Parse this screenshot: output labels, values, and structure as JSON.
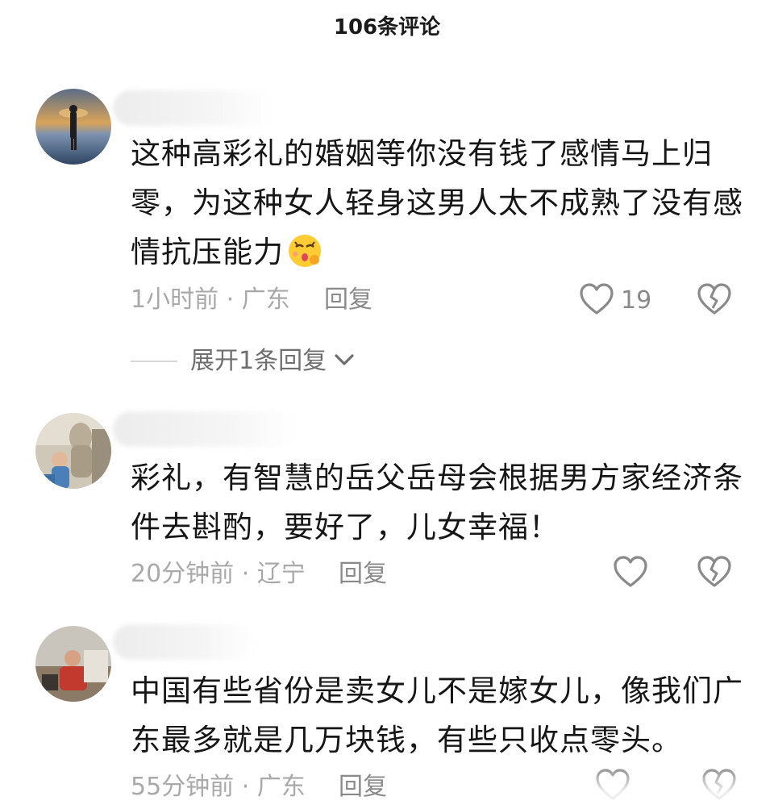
{
  "header": {
    "title": "106条评论"
  },
  "comments": [
    {
      "text": "这种高彩礼的婚姻等你没有钱了感情马上归零，为这种女人轻身这男人太不成熟了没有感情抗压能力",
      "emoji": "pleading-face-emoji",
      "time_location": "1小时前 · 广东",
      "reply_label": "回复",
      "likes": "19",
      "expand_label": "展开1条回复"
    },
    {
      "text": "彩礼，有智慧的岳父岳母会根据男方家经济条件去斟酌，要好了，儿女幸福！",
      "time_location": "20分钟前 · 辽宁",
      "reply_label": "回复",
      "likes": ""
    },
    {
      "text": "中国有些省份是卖女儿不是嫁女儿，像我们广东最多就是几万块钱，有些只收点零头。",
      "time_location": "55分钟前 · 广东",
      "reply_label": "回复",
      "likes": ""
    }
  ],
  "icons": {
    "like": "heart-outline-icon",
    "dislike": "broken-heart-icon",
    "expand": "chevron-down-icon"
  },
  "colors": {
    "text": "#161616",
    "meta": "#a9a9a9",
    "icon": "#8a8a8a"
  }
}
